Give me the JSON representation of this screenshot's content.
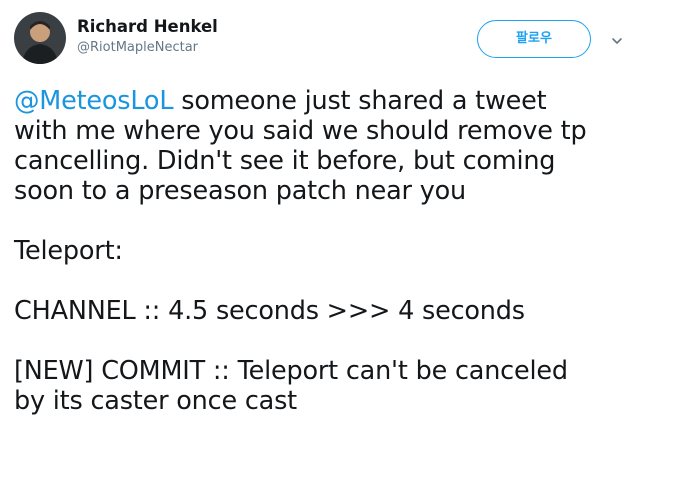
{
  "author": {
    "display_name": "Richard Henkel",
    "handle": "@RiotMapleNectar",
    "avatar_icon": "profile-photo"
  },
  "follow_button": {
    "label": "팔로우"
  },
  "menu": {
    "icon": "chevron-down-icon"
  },
  "tweet": {
    "mention": "@MeteosLoL",
    "intro_after_mention": " someone just shared a tweet",
    "intro_line2": "with me where you said we should remove tp",
    "intro_line3": "cancelling. Didn't see it before, but coming",
    "intro_line4": "soon to a preseason patch near you",
    "section_title": "Teleport:",
    "channel_line": "CHANNEL :: 4.5 seconds >>> 4 seconds",
    "commit_line1": "[NEW] COMMIT :: Teleport can't be canceled",
    "commit_line2": "by its caster once cast"
  },
  "colors": {
    "link": "#1b95e0",
    "follow_border": "#1da1f2",
    "text": "#14171a",
    "secondary_text": "#657786"
  }
}
